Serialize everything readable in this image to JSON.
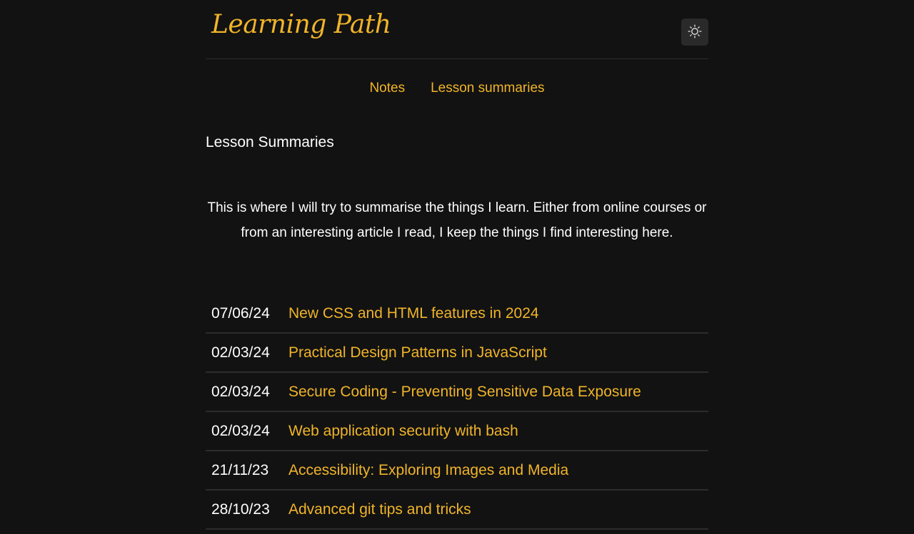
{
  "header": {
    "logo_text": "Learning Path",
    "theme_toggle_icon": "sun-icon"
  },
  "nav": {
    "items": [
      {
        "label": "Notes"
      },
      {
        "label": "Lesson summaries"
      }
    ]
  },
  "main": {
    "title": "Lesson Summaries",
    "intro": "This is where I will try to summarise the things I learn. Either from online courses or from an interesting article I read, I keep the things I find interesting here.",
    "lessons": [
      {
        "date": "07/06/24",
        "title": "New CSS and HTML features in 2024"
      },
      {
        "date": "02/03/24",
        "title": "Practical Design Patterns in JavaScript"
      },
      {
        "date": "02/03/24",
        "title": "Secure Coding - Preventing Sensitive Data Exposure"
      },
      {
        "date": "02/03/24",
        "title": "Web application security with bash"
      },
      {
        "date": "21/11/23",
        "title": "Accessibility: Exploring Images and Media"
      },
      {
        "date": "28/10/23",
        "title": "Advanced git tips and tricks"
      }
    ]
  },
  "colors": {
    "background": "#121212",
    "accent": "#f0b429",
    "text": "#ffffff",
    "divider": "#2c2c2c"
  }
}
